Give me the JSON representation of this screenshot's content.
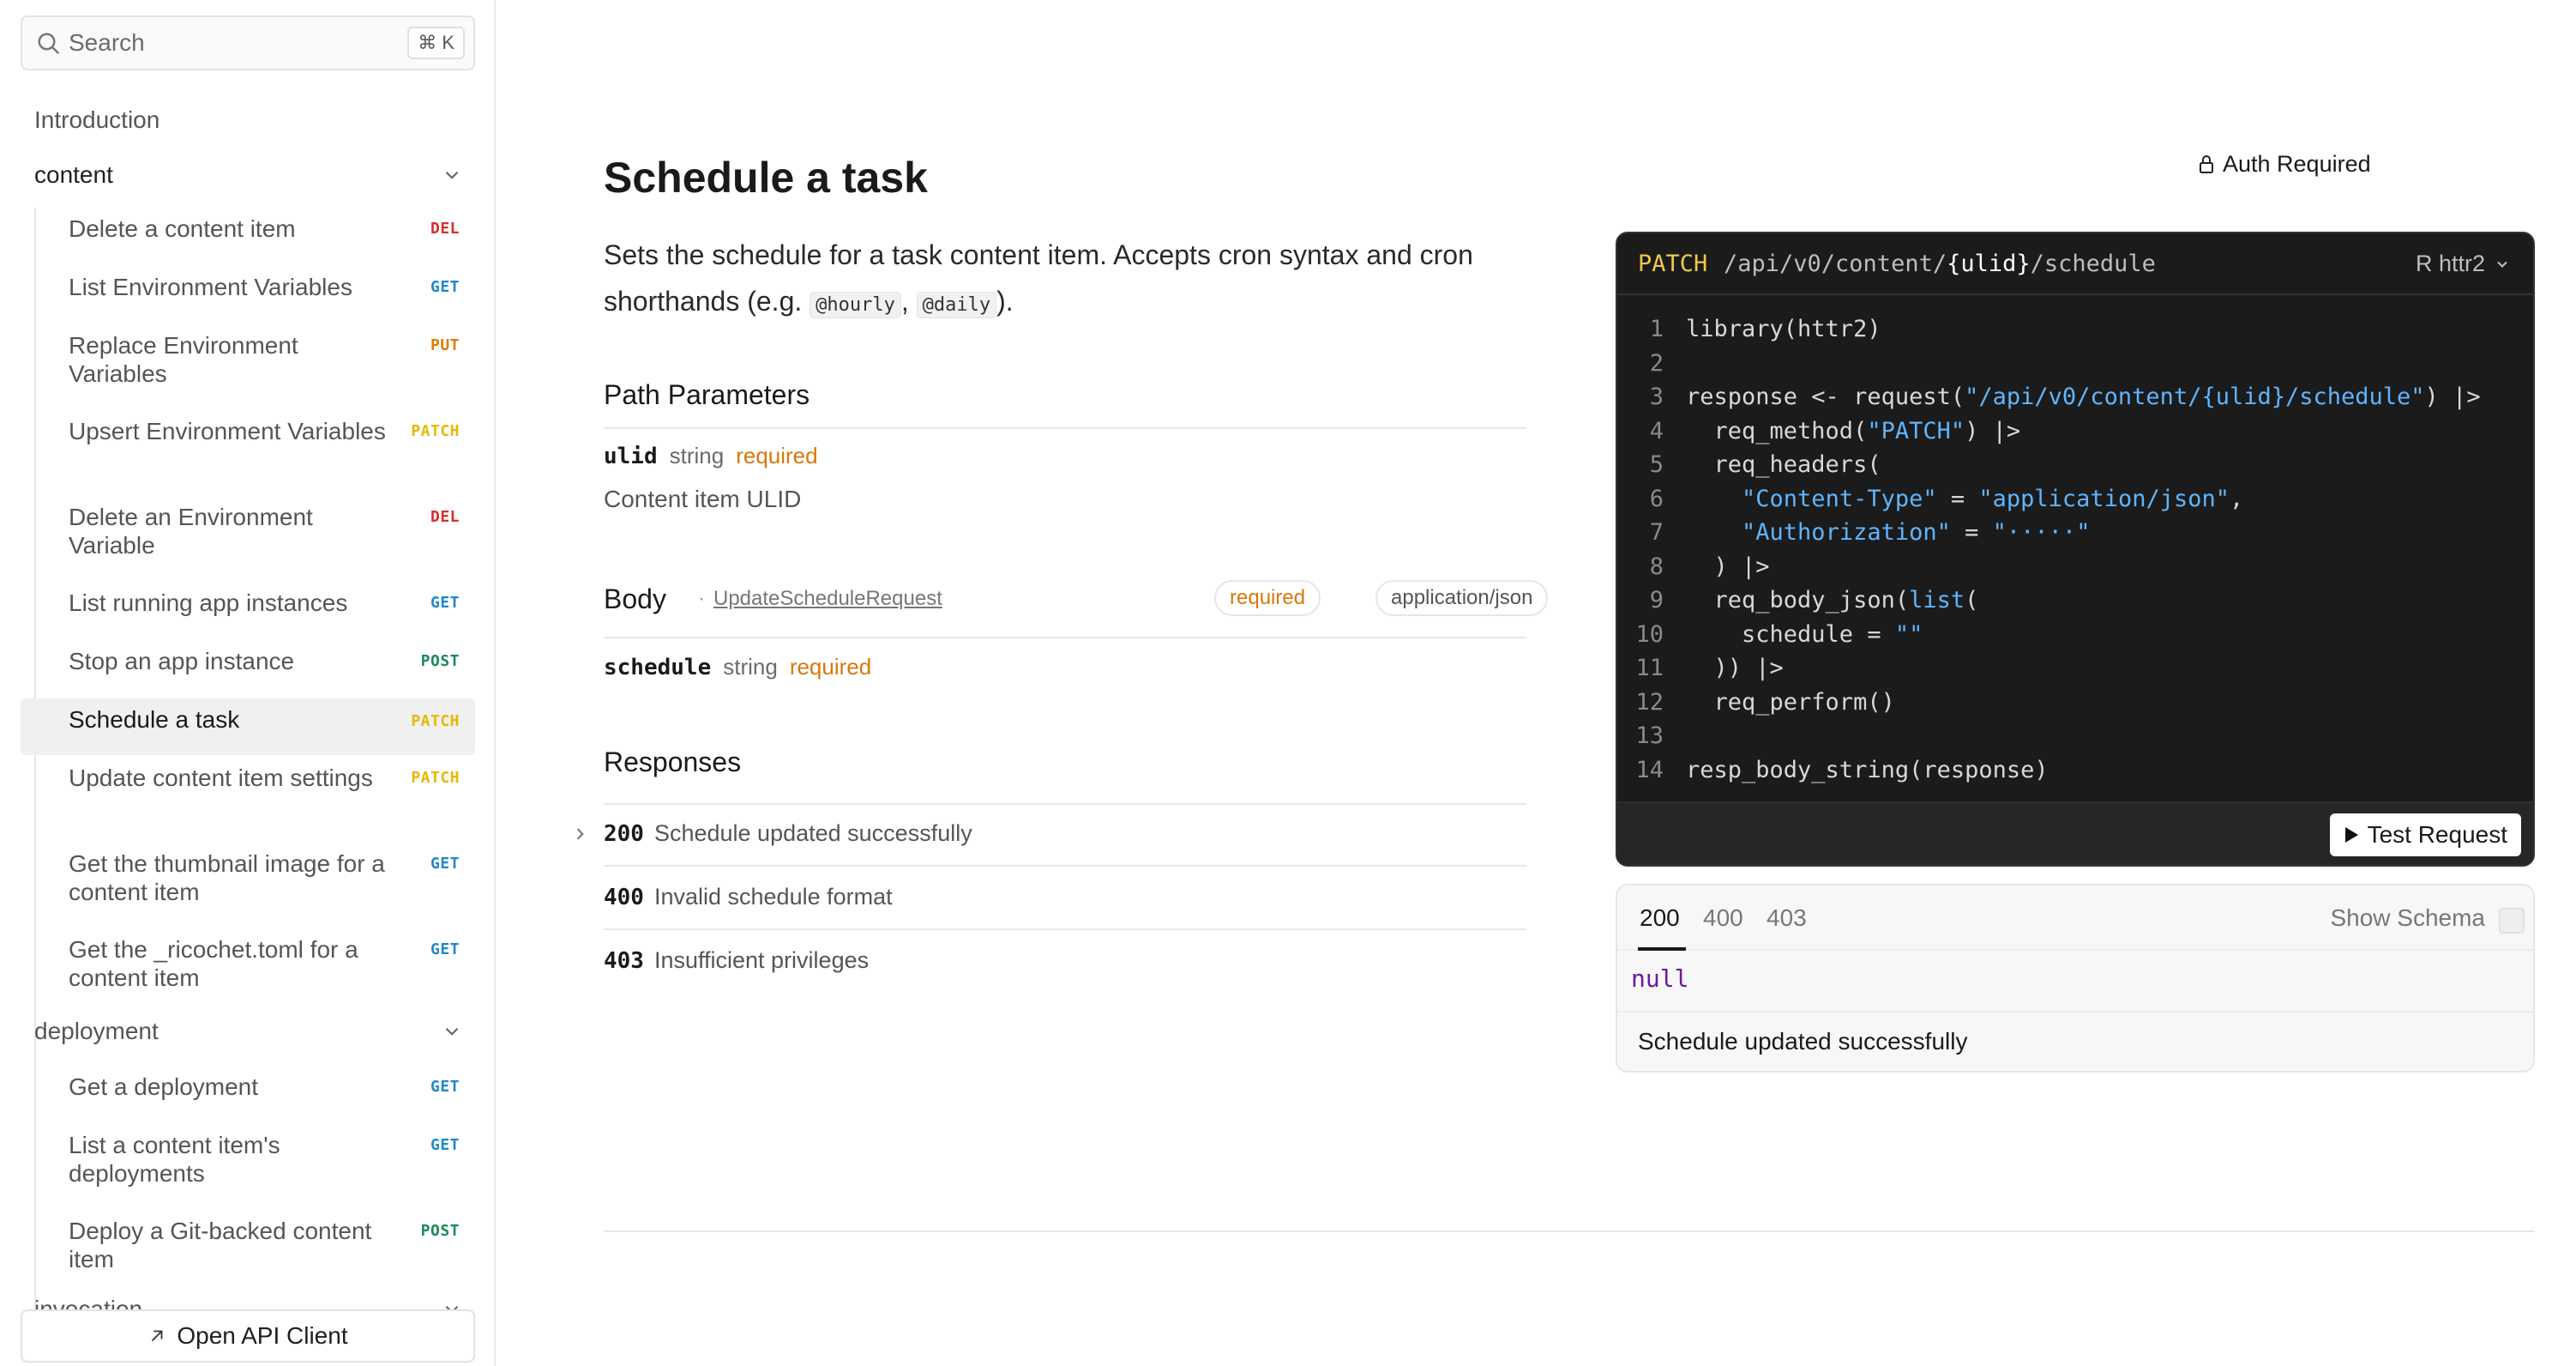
{
  "sidebar": {
    "search": {
      "placeholder": "Search",
      "shortcut": "⌘ K"
    },
    "introduction": "Introduction",
    "groups": {
      "content": "content",
      "deployment": "deployment",
      "invocation": "invocation"
    },
    "content_items": [
      {
        "label": "Delete a content item",
        "method": "DEL"
      },
      {
        "label": "List Environment Variables",
        "method": "GET"
      },
      {
        "label": "Replace Environment Variables",
        "method": "PUT"
      },
      {
        "label": "Upsert Environment Variables",
        "method": "PATCH"
      },
      {
        "label": "Delete an Environment Variable",
        "method": "DEL"
      },
      {
        "label": "List running app instances",
        "method": "GET"
      },
      {
        "label": "Stop an app instance",
        "method": "POST"
      },
      {
        "label": "Schedule a task",
        "method": "PATCH"
      },
      {
        "label": "Update content item settings",
        "method": "PATCH"
      },
      {
        "label": "Get the thumbnail image for a content item",
        "method": "GET"
      },
      {
        "label": "Get the _ricochet.toml for a content item",
        "method": "GET"
      }
    ],
    "deployment_items": [
      {
        "label": "Get a deployment",
        "method": "GET"
      },
      {
        "label": "List a content item's deployments",
        "method": "GET"
      },
      {
        "label": "Deploy a Git-backed content item",
        "method": "POST"
      }
    ],
    "open_client": "Open API Client"
  },
  "colors": {
    "DEL": "#d32f2f",
    "GET": "#1e88c7",
    "PUT": "#e07b00",
    "PATCH": "#e6b800",
    "POST": "#1a8a5a"
  },
  "main": {
    "title": "Schedule a task",
    "description_prefix": "Sets the schedule for a task content item. Accepts cron syntax and cron shorthands (e.g. ",
    "description_code1": "@hourly",
    "description_sep": ", ",
    "description_code2": "@daily",
    "description_suffix": ").",
    "auth": "Auth Required",
    "path_params": {
      "heading": "Path Parameters",
      "name": "ulid",
      "type": "string",
      "required": "required",
      "description": "Content item ULID"
    },
    "body": {
      "heading": "Body",
      "separator": "·",
      "schema_link": "UpdateScheduleRequest",
      "required_pill": "required",
      "content_type_pill": "application/json",
      "field_name": "schedule",
      "field_type": "string",
      "field_required": "required"
    },
    "responses": {
      "heading": "Responses",
      "items": [
        {
          "code": "200",
          "description": "Schedule updated successfully"
        },
        {
          "code": "400",
          "description": "Invalid schedule format"
        },
        {
          "code": "403",
          "description": "Insufficient privileges"
        }
      ]
    }
  },
  "code": {
    "method": "PATCH",
    "path_prefix": "/api/v0/content/",
    "path_param": "{ulid}",
    "path_suffix": "/schedule",
    "language": "R httr2",
    "line_numbers": [
      "1",
      "2",
      "3",
      "4",
      "5",
      "6",
      "7",
      "8",
      "9",
      "10",
      "11",
      "12",
      "13",
      "14"
    ],
    "test_button": "Test Request"
  },
  "response_panel": {
    "tabs": [
      "200",
      "400",
      "403"
    ],
    "show_schema": "Show Schema",
    "body": "null",
    "description": "Schedule updated successfully"
  }
}
